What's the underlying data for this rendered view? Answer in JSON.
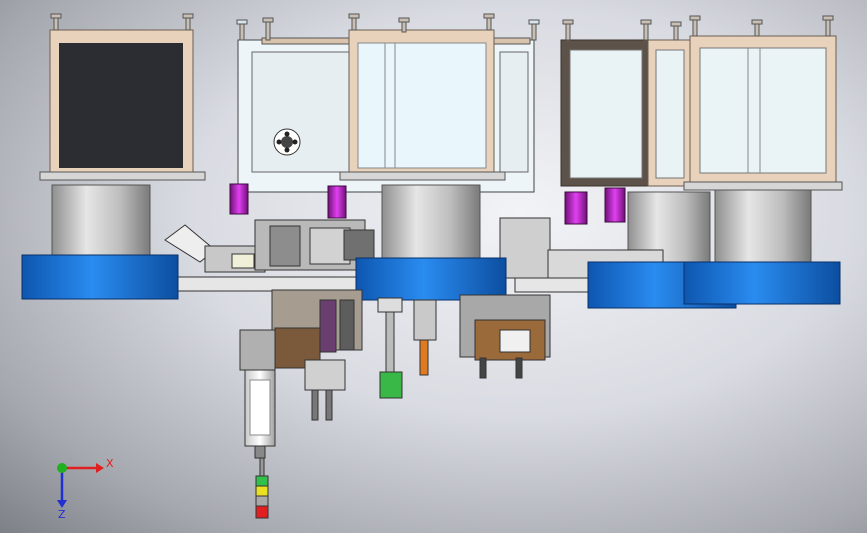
{
  "colors": {
    "background": "#d8dae0",
    "frame": "#e5cdb6",
    "frame_dark": "#5e544b",
    "panel": "#eaf2f6",
    "drum": "#c8c8c8",
    "bowl": "#1e78d6",
    "magenta": "#b020b8",
    "axis_x": "#e02020",
    "axis_y": "#20b020",
    "axis_z": "#2030d0"
  },
  "triad": {
    "x_label": "X",
    "z_label": "Z"
  }
}
